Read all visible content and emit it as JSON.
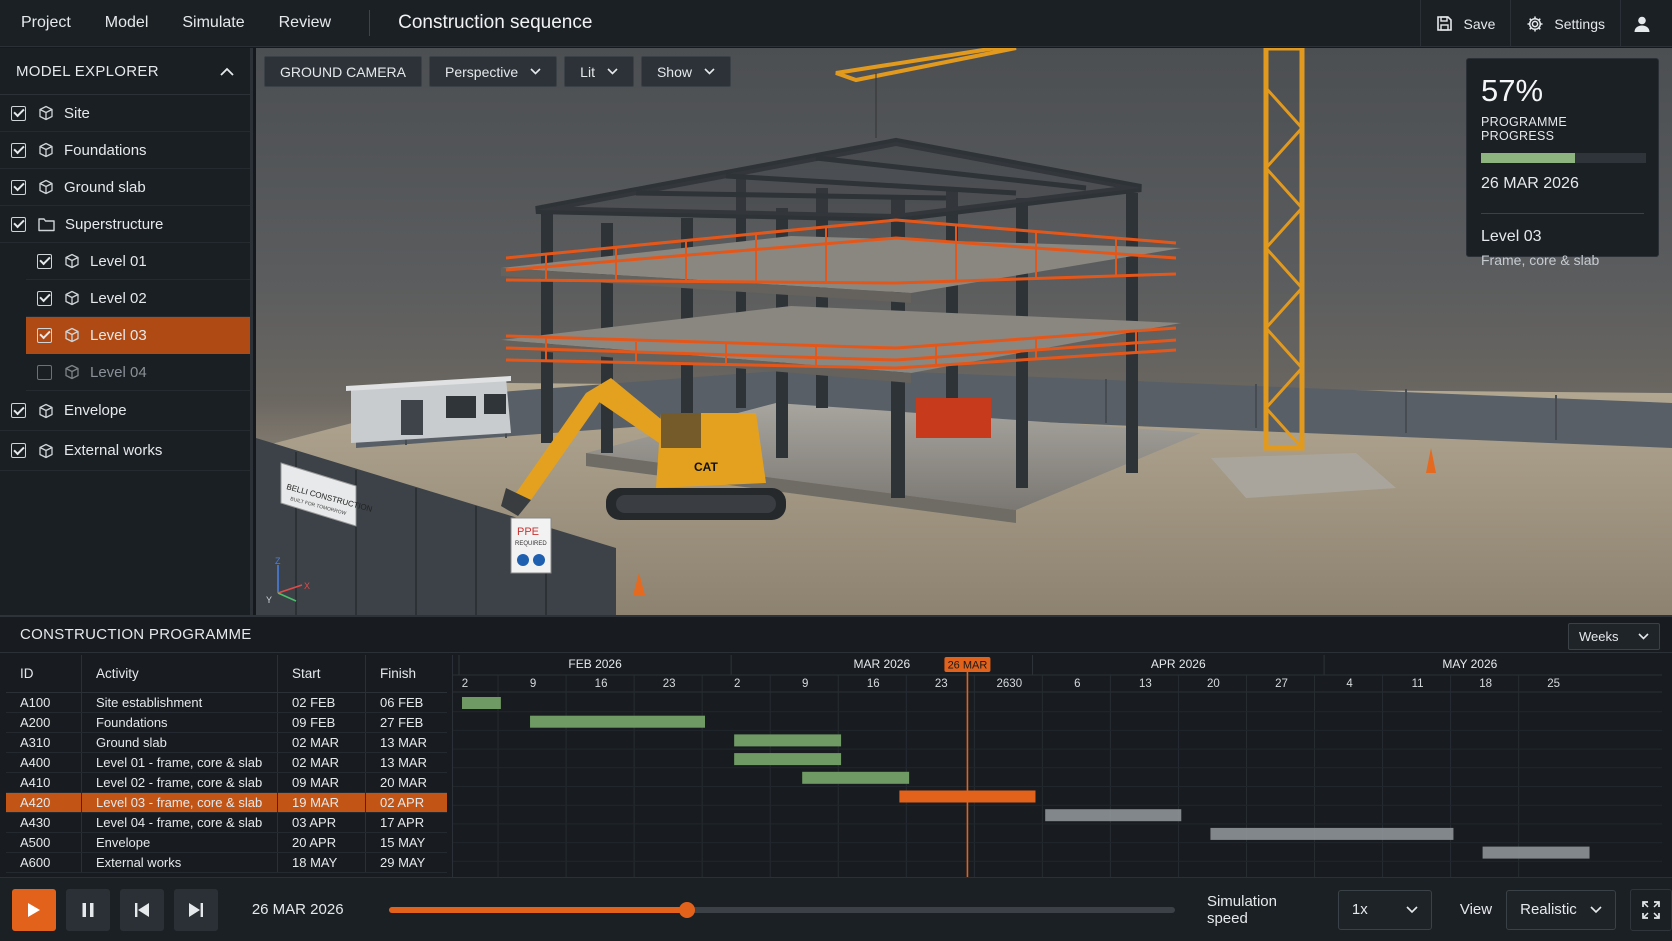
{
  "menu": [
    "Project",
    "Model",
    "Simulate",
    "Review"
  ],
  "app_title": "Construction sequence",
  "header_actions": {
    "save": "Save",
    "settings": "Settings"
  },
  "explorer": {
    "title": "MODEL EXPLORER",
    "items": [
      {
        "label": "Site",
        "checked": true,
        "type": "cube"
      },
      {
        "label": "Foundations",
        "checked": true,
        "type": "cube"
      },
      {
        "label": "Ground slab",
        "checked": true,
        "type": "cube"
      },
      {
        "label": "Superstructure",
        "checked": true,
        "type": "folder"
      },
      {
        "label": "Level 01",
        "checked": true,
        "type": "cube",
        "child": true
      },
      {
        "label": "Level 02",
        "checked": true,
        "type": "cube",
        "child": true
      },
      {
        "label": "Level 03",
        "checked": true,
        "type": "cube",
        "child": true,
        "selected": true
      },
      {
        "label": "Level 04",
        "checked": false,
        "type": "cube",
        "child": true
      },
      {
        "label": "Envelope",
        "checked": true,
        "type": "cube"
      },
      {
        "label": "External works",
        "checked": true,
        "type": "cube"
      }
    ]
  },
  "viewport": {
    "camera": "GROUND CAMERA",
    "projection": "Perspective",
    "lighting": "Lit",
    "show": "Show",
    "site_sign": [
      "BELLI CONSTRUCTION",
      "BUILT FOR TOMORROW"
    ],
    "ppe_sign": [
      "PPE",
      "REQUIRED"
    ],
    "excavator_brand": "CAT",
    "axes": {
      "z": "Z",
      "y": "Y",
      "x": "X"
    }
  },
  "progress_card": {
    "percent_text": "57%",
    "percent": 57,
    "label": "PROGRAMME PROGRESS",
    "date": "26 MAR 2026",
    "level": "Level 03",
    "level_desc": "Frame, core & slab"
  },
  "programme": {
    "title": "CONSTRUCTION PROGRAMME",
    "scale": "Weeks",
    "columns": [
      "ID",
      "Activity",
      "Start",
      "Finish"
    ],
    "rows": [
      {
        "id": "A100",
        "activity": "Site establishment",
        "start": "02 FEB",
        "finish": "06 FEB",
        "s": 0,
        "e": 4,
        "status": "done"
      },
      {
        "id": "A200",
        "activity": "Foundations",
        "start": "09 FEB",
        "finish": "27 FEB",
        "s": 7,
        "e": 25,
        "status": "done"
      },
      {
        "id": "A310",
        "activity": "Ground slab",
        "start": "02 MAR",
        "finish": "13 MAR",
        "s": 28,
        "e": 39,
        "status": "done"
      },
      {
        "id": "A400",
        "activity": "Level 01 - frame, core & slab",
        "start": "02 MAR",
        "finish": "13 MAR",
        "s": 28,
        "e": 39,
        "status": "done"
      },
      {
        "id": "A410",
        "activity": "Level 02 - frame, core & slab",
        "start": "09 MAR",
        "finish": "20 MAR",
        "s": 35,
        "e": 46,
        "status": "done"
      },
      {
        "id": "A420",
        "activity": "Level 03 - frame, core & slab",
        "start": "19 MAR",
        "finish": "02 APR",
        "s": 45,
        "e": 59,
        "status": "active",
        "selected": true
      },
      {
        "id": "A430",
        "activity": "Level 04 - frame, core & slab",
        "start": "03 APR",
        "finish": "17 APR",
        "s": 60,
        "e": 74,
        "status": "planned"
      },
      {
        "id": "A500",
        "activity": "Envelope",
        "start": "20 APR",
        "finish": "15 MAY",
        "s": 77,
        "e": 102,
        "status": "planned"
      },
      {
        "id": "A600",
        "activity": "External works",
        "start": "18 MAY",
        "finish": "29 MAY",
        "s": 105,
        "e": 116,
        "status": "planned"
      }
    ],
    "months": [
      {
        "label": "FEB 2026",
        "s": 0,
        "e": 28
      },
      {
        "label": "MAR 2026",
        "s": 28,
        "e": 59
      },
      {
        "label": "APR 2026",
        "s": 59,
        "e": 89
      },
      {
        "label": "MAY 2026",
        "s": 89,
        "e": 119
      }
    ],
    "day_ticks": [
      {
        "label": "2",
        "d": 0
      },
      {
        "label": "9",
        "d": 7
      },
      {
        "label": "16",
        "d": 14
      },
      {
        "label": "23",
        "d": 21
      },
      {
        "label": "2",
        "d": 28
      },
      {
        "label": "9",
        "d": 35
      },
      {
        "label": "16",
        "d": 42
      },
      {
        "label": "23",
        "d": 49
      },
      {
        "label": "2630",
        "d": 56
      },
      {
        "label": "6",
        "d": 63
      },
      {
        "label": "13",
        "d": 70
      },
      {
        "label": "20",
        "d": 77
      },
      {
        "label": "27",
        "d": 84
      },
      {
        "label": "4",
        "d": 91
      },
      {
        "label": "11",
        "d": 98
      },
      {
        "label": "18",
        "d": 105
      },
      {
        "label": "25",
        "d": 112
      }
    ],
    "today": {
      "label": "26 MAR",
      "d": 52
    }
  },
  "playback": {
    "date": "26 MAR 2026",
    "position": 0.38,
    "speed_label": "Simulation speed",
    "speed": "1x",
    "view_label": "View",
    "view": "Realistic"
  },
  "colors": {
    "accent": "#e2621c",
    "done_bar": "#6f9a64",
    "planned_bar": "#8e9398",
    "progress_fill": "#8db37e",
    "steel": "#2e3338",
    "safety_rail": "#e4571a",
    "crane": "#e29a1e"
  }
}
